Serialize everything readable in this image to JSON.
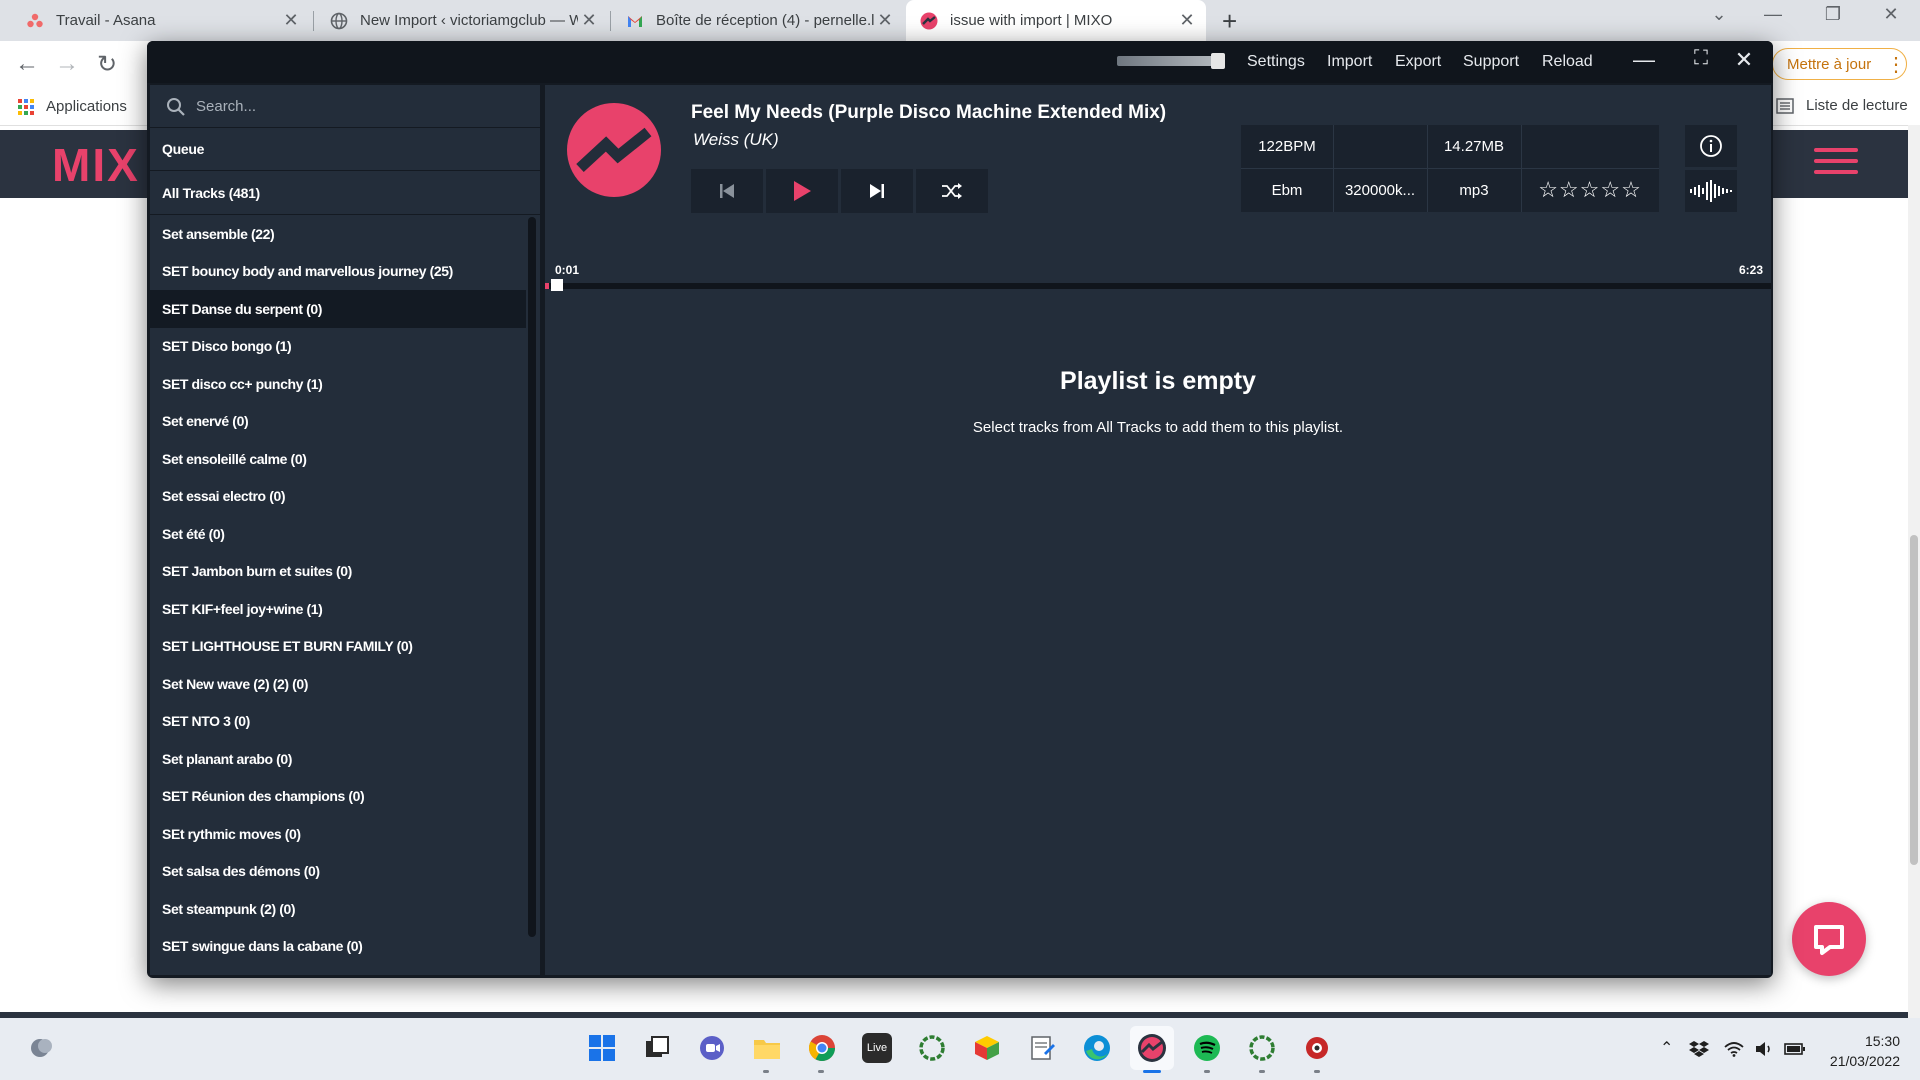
{
  "browser": {
    "tabs": [
      {
        "title": "Travail - Asana",
        "favicon": "asana-icon"
      },
      {
        "title": "New Import ‹ victoriamgclub — W",
        "favicon": "globe-icon"
      },
      {
        "title": "Boîte de réception (4) - pernelle.l",
        "favicon": "gmail-icon"
      },
      {
        "title": "issue with import | MIXO",
        "favicon": "mixo-icon"
      }
    ],
    "update_label": "Mettre à jour",
    "bookmarks_apps": "Applications",
    "reading_list": "Liste de lecture"
  },
  "site": {
    "logo_text": "MIX"
  },
  "app": {
    "menu": [
      "Settings",
      "Import",
      "Export",
      "Support",
      "Reload"
    ],
    "search_placeholder": "Search...",
    "queue_label": "Queue",
    "all_tracks_label": "All Tracks (481)",
    "playlists": [
      "Set ansemble (22)",
      "SET bouncy body and marvellous journey (25)",
      "SET Danse du serpent (0)",
      "SET Disco bongo (1)",
      "SET disco cc+ punchy (1)",
      "Set enervé (0)",
      "Set ensoleillé calme (0)",
      "Set essai electro (0)",
      "Set été (0)",
      "SET Jambon burn et suites (0)",
      "SET KIF+feel joy+wine (1)",
      "SET LIGHTHOUSE ET BURN FAMILY (0)",
      "Set New wave (2) (2) (0)",
      "SET NTO 3 (0)",
      "Set planant arabo (0)",
      "SET Réunion des champions (0)",
      "SEt rythmic moves (0)",
      "Set salsa des démons (0)",
      "Set steampunk (2) (0)",
      "SET swingue dans la cabane (0)"
    ],
    "selected_playlist_index": 2,
    "track": {
      "title": "Feel My Needs (Purple Disco Machine Extended Mix)",
      "artist": "Weiss (UK)",
      "bpm": "122BPM",
      "size": "14.27MB",
      "key": "Ebm",
      "bitrate": "320000k...",
      "format": "mp3",
      "rating": "☆☆☆☆☆",
      "rating_value": 0,
      "current_time": "0:01",
      "duration": "6:23",
      "progress_fraction": 0.003
    },
    "empty_title": "Playlist is empty",
    "empty_subtitle": "Select tracks from All Tracks to add them to this playlist.",
    "accent_color": "#e8426b"
  },
  "taskbar": {
    "time": "15:30",
    "date": "21/03/2022",
    "live_label": "Live"
  }
}
